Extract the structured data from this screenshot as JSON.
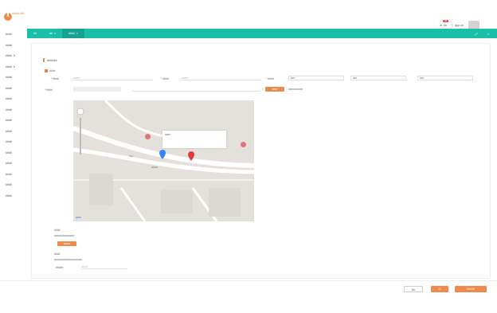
{
  "header": {
    "logo_text": "#####\n###",
    "message_label": "##",
    "message_badge": "##",
    "app_download_label": "App ##"
  },
  "sidebar": {
    "items": [
      {
        "label": "####"
      },
      {
        "label": "####"
      },
      {
        "label": "####",
        "chevron": "▾"
      },
      {
        "label": "####",
        "chevron": "▾"
      },
      {
        "label": "####"
      },
      {
        "label": "####"
      },
      {
        "label": "####"
      },
      {
        "label": "####"
      },
      {
        "label": "####"
      },
      {
        "label": "####"
      },
      {
        "label": "####"
      },
      {
        "label": "####"
      },
      {
        "label": "####"
      },
      {
        "label": "####"
      },
      {
        "label": "####"
      },
      {
        "label": "####"
      }
    ]
  },
  "tabs": [
    {
      "label": "##"
    },
    {
      "label": "##",
      "close": "×"
    },
    {
      "label": "####",
      "close": "×"
    }
  ],
  "tab_actions": {
    "expand": "⤢",
    "close": "×"
  },
  "form": {
    "section_title": "######",
    "subsection_label": "####",
    "field1_label": "* ####",
    "field1_placeholder": "#####",
    "field2_label": "* ####",
    "field2_placeholder": "#####",
    "region_label": "* ####",
    "province_value": "###",
    "city_value": "###",
    "district_value": "###",
    "address_label": "* ####",
    "locate_button": "####",
    "locate_hint": "###########",
    "map_popup_title": "####",
    "map_road_1": "###",
    "map_road_2": "#####",
    "map_watermark": "####",
    "note_title": "####",
    "note_text": "###############",
    "note_button": "#####",
    "extra_title": "####",
    "extra_text": "#####################",
    "extra_field_label": "#####",
    "extra_field_placeholder": "#####"
  },
  "footer": {
    "cancel": "##",
    "save": "##",
    "submit": "#####"
  },
  "colors": {
    "accent": "#1bbfa9",
    "primary_button": "#f08a4b"
  }
}
